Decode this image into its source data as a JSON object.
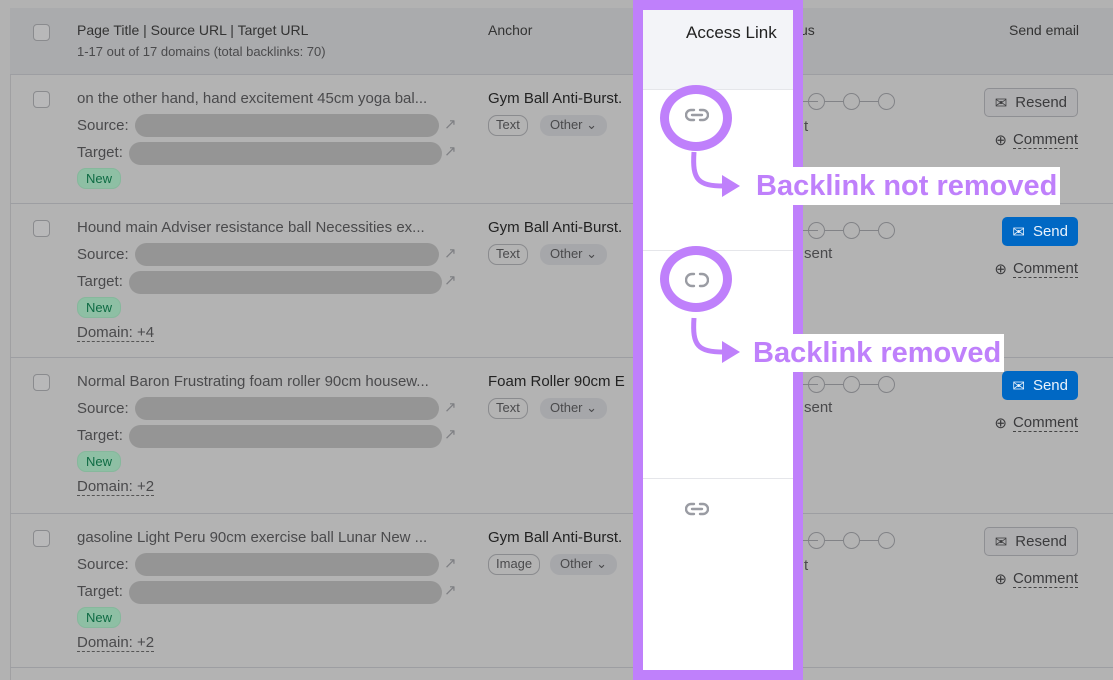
{
  "header": {
    "title_col": "Page Title | Source URL | Target URL",
    "subtitle": "1-17 out of 17 domains (total backlinks: 70)",
    "anchor_col": "Anchor",
    "access_link_col": "Access Link",
    "status_col_fragment": "us",
    "send_email_col": "Send email"
  },
  "labels": {
    "source": "Source:",
    "target": "Target:",
    "new": "New",
    "comment": "Comment",
    "other": "Other"
  },
  "rows": [
    {
      "title": "on the other hand, hand excitement 45cm yoga bal...",
      "anchor": "Gym Ball Anti-Burst.",
      "type": "Text",
      "domain": "",
      "status_fragment": "t",
      "button": "Resend",
      "access_link": "link-icon"
    },
    {
      "title": "Hound main Adviser resistance ball Necessities ex...",
      "anchor": "Gym Ball Anti-Burst.",
      "type": "Text",
      "domain": "Domain: +4",
      "status_fragment": "sent",
      "button": "Send",
      "access_link": "broken-link-icon"
    },
    {
      "title": "Normal Baron Frustrating foam roller 90cm housew...",
      "anchor": "Foam Roller 90cm E",
      "type": "Text",
      "domain": "Domain: +2",
      "status_fragment": "sent",
      "button": "Send",
      "access_link": ""
    },
    {
      "title": "gasoline Light Peru 90cm exercise ball Lunar New ...",
      "anchor": "Gym Ball Anti-Burst.",
      "type": "Image",
      "domain": "Domain: +2",
      "status_fragment": "t",
      "button": "Resend",
      "access_link": "link-icon"
    }
  ],
  "annotations": {
    "not_removed": "Backlink not removed",
    "removed": "Backlink removed"
  },
  "colors": {
    "highlight": "#bf80fb",
    "send": "#0068c4",
    "new_badge": "#8ebfa4"
  }
}
